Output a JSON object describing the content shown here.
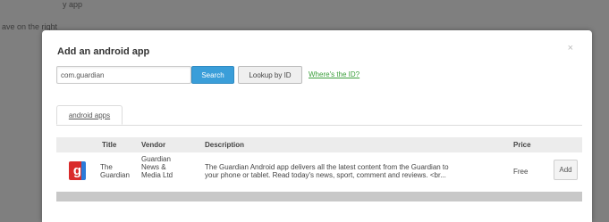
{
  "backdrop": {
    "line1": "y app",
    "line2": "ave on the right"
  },
  "modal": {
    "title": "Add an android app",
    "close_label": "×"
  },
  "search": {
    "value": "com.guardian",
    "search_label": "Search",
    "lookup_label": "Lookup by ID",
    "where_link": "Where's the ID?"
  },
  "tabs": [
    {
      "label": "android apps"
    }
  ],
  "table": {
    "columns": [
      "Title",
      "Vendor",
      "Description",
      "Price"
    ],
    "rows": [
      {
        "icon_letter": "g",
        "title_1": "The",
        "title_2": "Guardian",
        "vendor_1": "Guardian",
        "vendor_2": "News &",
        "vendor_3": "Media Ltd",
        "description_1": "The Guardian Android app delivers all the latest content from the Guardian to",
        "description_2": "your phone or tablet. Read today's news, sport, comment and reviews. <br...",
        "price": "Free",
        "action_label": "Add"
      }
    ]
  },
  "colors": {
    "accent": "#3a9ed9",
    "link": "#3a9e3a",
    "overlay": "#7f7f7f"
  }
}
